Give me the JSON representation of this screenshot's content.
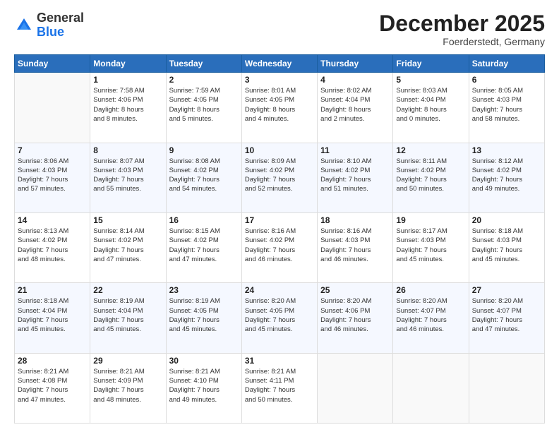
{
  "logo": {
    "general": "General",
    "blue": "Blue"
  },
  "header": {
    "month": "December 2025",
    "location": "Foerderstedt, Germany"
  },
  "weekdays": [
    "Sunday",
    "Monday",
    "Tuesday",
    "Wednesday",
    "Thursday",
    "Friday",
    "Saturday"
  ],
  "weeks": [
    [
      {
        "day": "",
        "info": ""
      },
      {
        "day": "1",
        "info": "Sunrise: 7:58 AM\nSunset: 4:06 PM\nDaylight: 8 hours\nand 8 minutes."
      },
      {
        "day": "2",
        "info": "Sunrise: 7:59 AM\nSunset: 4:05 PM\nDaylight: 8 hours\nand 5 minutes."
      },
      {
        "day": "3",
        "info": "Sunrise: 8:01 AM\nSunset: 4:05 PM\nDaylight: 8 hours\nand 4 minutes."
      },
      {
        "day": "4",
        "info": "Sunrise: 8:02 AM\nSunset: 4:04 PM\nDaylight: 8 hours\nand 2 minutes."
      },
      {
        "day": "5",
        "info": "Sunrise: 8:03 AM\nSunset: 4:04 PM\nDaylight: 8 hours\nand 0 minutes."
      },
      {
        "day": "6",
        "info": "Sunrise: 8:05 AM\nSunset: 4:03 PM\nDaylight: 7 hours\nand 58 minutes."
      }
    ],
    [
      {
        "day": "7",
        "info": "Sunrise: 8:06 AM\nSunset: 4:03 PM\nDaylight: 7 hours\nand 57 minutes."
      },
      {
        "day": "8",
        "info": "Sunrise: 8:07 AM\nSunset: 4:03 PM\nDaylight: 7 hours\nand 55 minutes."
      },
      {
        "day": "9",
        "info": "Sunrise: 8:08 AM\nSunset: 4:02 PM\nDaylight: 7 hours\nand 54 minutes."
      },
      {
        "day": "10",
        "info": "Sunrise: 8:09 AM\nSunset: 4:02 PM\nDaylight: 7 hours\nand 52 minutes."
      },
      {
        "day": "11",
        "info": "Sunrise: 8:10 AM\nSunset: 4:02 PM\nDaylight: 7 hours\nand 51 minutes."
      },
      {
        "day": "12",
        "info": "Sunrise: 8:11 AM\nSunset: 4:02 PM\nDaylight: 7 hours\nand 50 minutes."
      },
      {
        "day": "13",
        "info": "Sunrise: 8:12 AM\nSunset: 4:02 PM\nDaylight: 7 hours\nand 49 minutes."
      }
    ],
    [
      {
        "day": "14",
        "info": "Sunrise: 8:13 AM\nSunset: 4:02 PM\nDaylight: 7 hours\nand 48 minutes."
      },
      {
        "day": "15",
        "info": "Sunrise: 8:14 AM\nSunset: 4:02 PM\nDaylight: 7 hours\nand 47 minutes."
      },
      {
        "day": "16",
        "info": "Sunrise: 8:15 AM\nSunset: 4:02 PM\nDaylight: 7 hours\nand 47 minutes."
      },
      {
        "day": "17",
        "info": "Sunrise: 8:16 AM\nSunset: 4:02 PM\nDaylight: 7 hours\nand 46 minutes."
      },
      {
        "day": "18",
        "info": "Sunrise: 8:16 AM\nSunset: 4:03 PM\nDaylight: 7 hours\nand 46 minutes."
      },
      {
        "day": "19",
        "info": "Sunrise: 8:17 AM\nSunset: 4:03 PM\nDaylight: 7 hours\nand 45 minutes."
      },
      {
        "day": "20",
        "info": "Sunrise: 8:18 AM\nSunset: 4:03 PM\nDaylight: 7 hours\nand 45 minutes."
      }
    ],
    [
      {
        "day": "21",
        "info": "Sunrise: 8:18 AM\nSunset: 4:04 PM\nDaylight: 7 hours\nand 45 minutes."
      },
      {
        "day": "22",
        "info": "Sunrise: 8:19 AM\nSunset: 4:04 PM\nDaylight: 7 hours\nand 45 minutes."
      },
      {
        "day": "23",
        "info": "Sunrise: 8:19 AM\nSunset: 4:05 PM\nDaylight: 7 hours\nand 45 minutes."
      },
      {
        "day": "24",
        "info": "Sunrise: 8:20 AM\nSunset: 4:05 PM\nDaylight: 7 hours\nand 45 minutes."
      },
      {
        "day": "25",
        "info": "Sunrise: 8:20 AM\nSunset: 4:06 PM\nDaylight: 7 hours\nand 46 minutes."
      },
      {
        "day": "26",
        "info": "Sunrise: 8:20 AM\nSunset: 4:07 PM\nDaylight: 7 hours\nand 46 minutes."
      },
      {
        "day": "27",
        "info": "Sunrise: 8:20 AM\nSunset: 4:07 PM\nDaylight: 7 hours\nand 47 minutes."
      }
    ],
    [
      {
        "day": "28",
        "info": "Sunrise: 8:21 AM\nSunset: 4:08 PM\nDaylight: 7 hours\nand 47 minutes."
      },
      {
        "day": "29",
        "info": "Sunrise: 8:21 AM\nSunset: 4:09 PM\nDaylight: 7 hours\nand 48 minutes."
      },
      {
        "day": "30",
        "info": "Sunrise: 8:21 AM\nSunset: 4:10 PM\nDaylight: 7 hours\nand 49 minutes."
      },
      {
        "day": "31",
        "info": "Sunrise: 8:21 AM\nSunset: 4:11 PM\nDaylight: 7 hours\nand 50 minutes."
      },
      {
        "day": "",
        "info": ""
      },
      {
        "day": "",
        "info": ""
      },
      {
        "day": "",
        "info": ""
      }
    ]
  ]
}
